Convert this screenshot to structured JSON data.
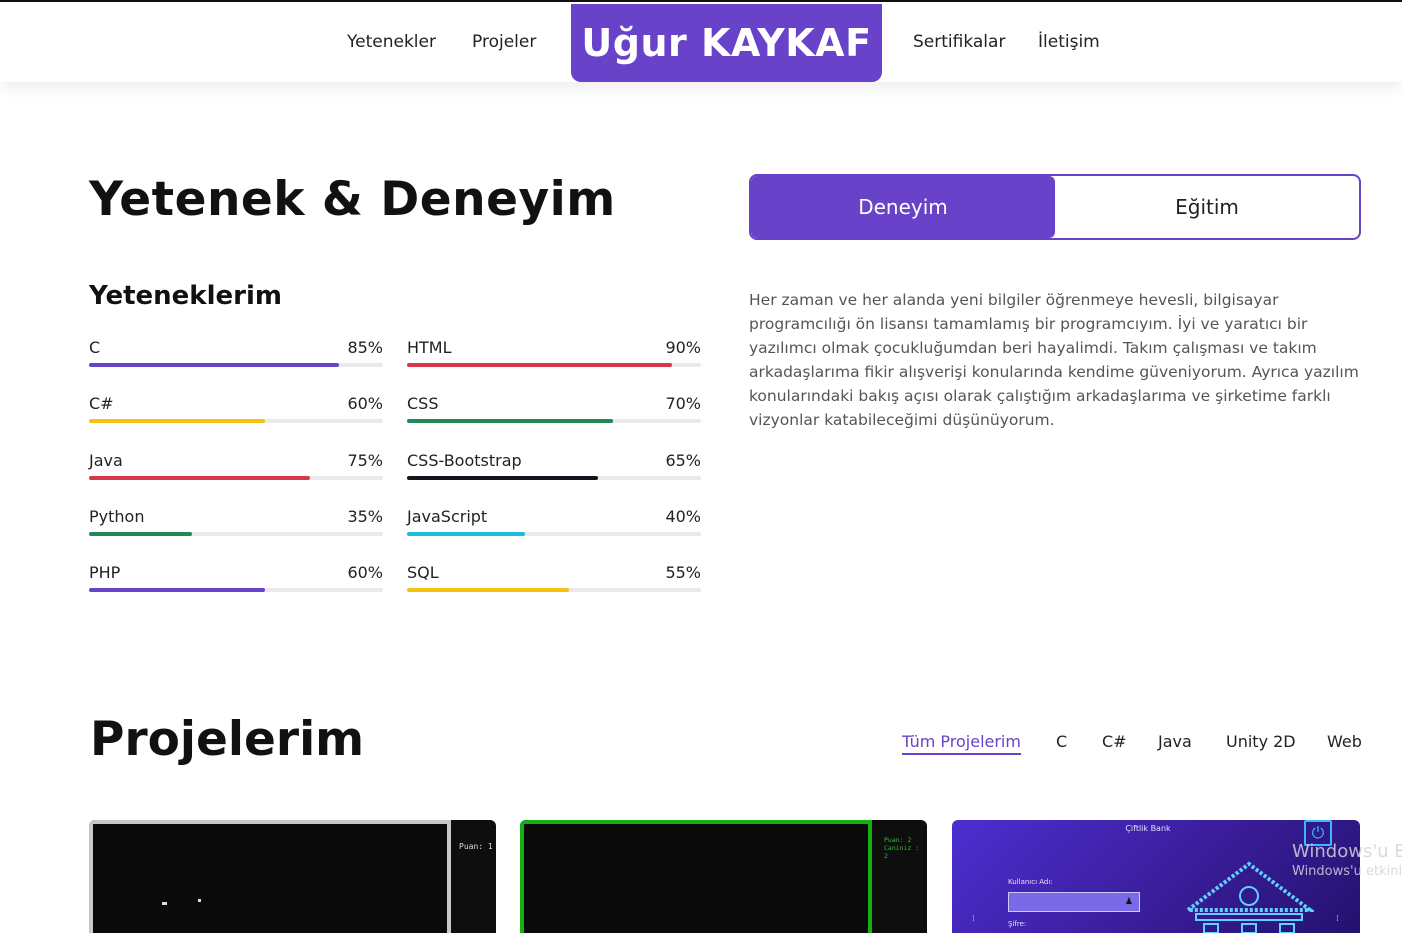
{
  "nav": {
    "brand": "Uğur KAYKAF",
    "links_left": [
      "Yetenekler",
      "Projeler"
    ],
    "links_right": [
      "Sertifikalar",
      "İletişim"
    ]
  },
  "skills_section": {
    "title": "Yetenek & Deneyim",
    "subtitle": "Yeteneklerim",
    "skills_left": [
      {
        "name": "C",
        "percent_label": "85%",
        "level": 85,
        "color": "#6843c9"
      },
      {
        "name": "C#",
        "percent_label": "60%",
        "level": 60,
        "color": "#f5c211"
      },
      {
        "name": "Java",
        "percent_label": "75%",
        "level": 75,
        "color": "#d9364a"
      },
      {
        "name": "Python",
        "percent_label": "35%",
        "level": 35,
        "color": "#1e8a56"
      },
      {
        "name": "PHP",
        "percent_label": "60%",
        "level": 60,
        "color": "#6843c9"
      }
    ],
    "skills_right": [
      {
        "name": "HTML",
        "percent_label": "90%",
        "level": 90,
        "color": "#d9364a"
      },
      {
        "name": "CSS",
        "percent_label": "70%",
        "level": 70,
        "color": "#1e8a56"
      },
      {
        "name": "CSS-Bootstrap",
        "percent_label": "65%",
        "level": 65,
        "color": "#15131e"
      },
      {
        "name": "JavaScript",
        "percent_label": "40%",
        "level": 40,
        "color": "#19c0d9"
      },
      {
        "name": "SQL",
        "percent_label": "55%",
        "level": 55,
        "color": "#f5c211"
      }
    ],
    "tabs": {
      "active": "Deneyim",
      "inactive": "Eğitim"
    },
    "description": "Her zaman ve her alanda yeni bilgiler öğrenmeye hevesli, bilgisayar programcılığı ön lisansı tamamlamış bir programcıyım. İyi ve yaratıcı bir yazılımcı olmak çocukluğumdan beri hayalimdi. Takım çalışması ve takım arkadaşlarıma fikir alışverişi konularında kendime güveniyorum. Ayrıca yazılım konularındaki bakış açısı olarak çalıştığım arkadaşlarıma ve şirketime farklı vizyonlar katabileceğimi düşünüyorum."
  },
  "projects_section": {
    "title": "Projelerim",
    "filters": [
      "Tüm Projelerim",
      "C",
      "C#",
      "Java",
      "Unity 2D",
      "Web"
    ],
    "active_filter": "Tüm Projelerim",
    "cards": {
      "card1_score": "Puan: 1",
      "card2_score_1": "Puan: 2",
      "card2_score_2": "Caninız : 2",
      "card3_title": "Çiftlik Bank",
      "card3_username_label": "Kullanıcı Adı:",
      "card3_password_label": "Şifre:"
    }
  },
  "watermark": {
    "line1": "Windows'u E",
    "line2": "Windows'u etkinl"
  },
  "colors": {
    "accent": "#6843c9"
  }
}
